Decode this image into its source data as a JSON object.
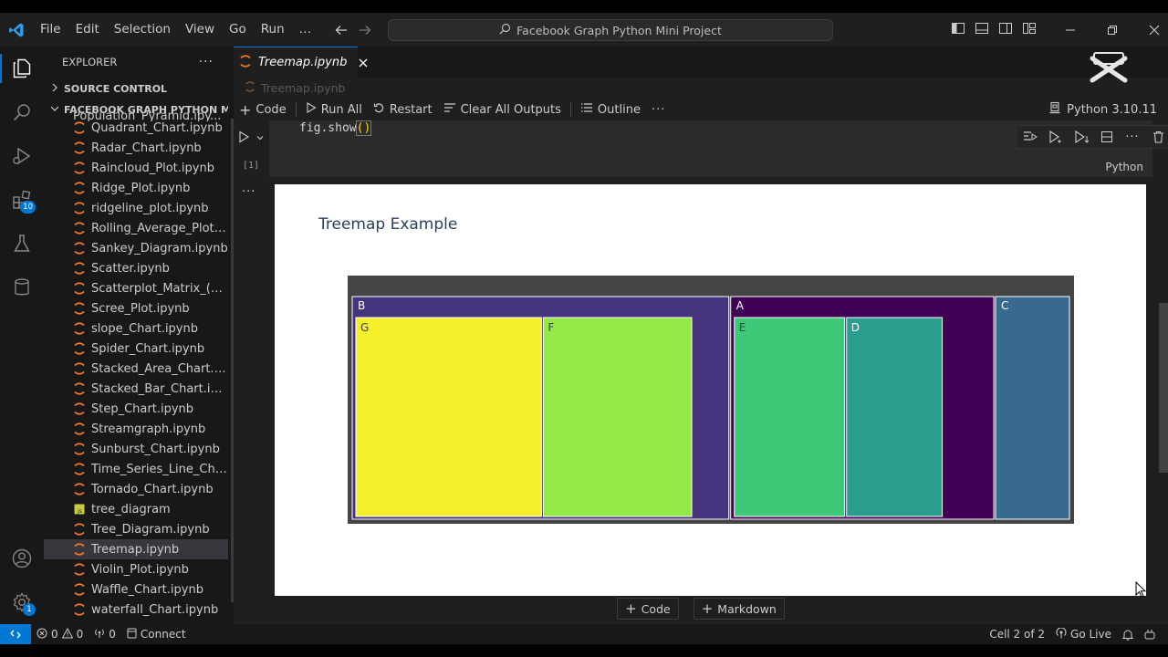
{
  "menu": {
    "items": [
      "File",
      "Edit",
      "Selection",
      "View",
      "Go",
      "Run",
      "…"
    ]
  },
  "command_center": {
    "text": "Facebook Graph Python Mini Project"
  },
  "sidebar": {
    "title": "EXPLORER",
    "more": "···",
    "source_control": "SOURCE CONTROL",
    "project": "FACEBOOK GRAPH PYTHON MI...",
    "partial_file": "Population_Pyramid.ipy...",
    "files": [
      {
        "name": "Quadrant_Chart.ipynb",
        "icon": "notebook-icon"
      },
      {
        "name": "Radar_Chart.ipynb",
        "icon": "notebook-icon"
      },
      {
        "name": "Raincloud_Plot.ipynb",
        "icon": "notebook-icon"
      },
      {
        "name": "Ridge_Plot.ipynb",
        "icon": "notebook-icon"
      },
      {
        "name": "ridgeline_plot.ipynb",
        "icon": "notebook-icon"
      },
      {
        "name": "Rolling_Average_Plot.ip...",
        "icon": "notebook-icon"
      },
      {
        "name": "Sankey_Diagram.ipynb",
        "icon": "notebook-icon"
      },
      {
        "name": "Scatter.ipynb",
        "icon": "notebook-icon"
      },
      {
        "name": "Scatterplot_Matrix_(SPL...",
        "icon": "notebook-icon"
      },
      {
        "name": "Scree_Plot.ipynb",
        "icon": "notebook-icon"
      },
      {
        "name": "slope_Chart.ipynb",
        "icon": "notebook-icon"
      },
      {
        "name": "Spider_Chart.ipynb",
        "icon": "notebook-icon"
      },
      {
        "name": "Stacked_Area_Chart.ipy...",
        "icon": "notebook-icon"
      },
      {
        "name": "Stacked_Bar_Chart.ipynb",
        "icon": "notebook-icon"
      },
      {
        "name": "Step_Chart.ipynb",
        "icon": "notebook-icon"
      },
      {
        "name": "Streamgraph.ipynb",
        "icon": "notebook-icon"
      },
      {
        "name": "Sunburst_Chart.ipynb",
        "icon": "notebook-icon"
      },
      {
        "name": "Time_Series_Line_Chart....",
        "icon": "notebook-icon"
      },
      {
        "name": "Tornado_Chart.ipynb",
        "icon": "notebook-icon"
      },
      {
        "name": "tree_diagram",
        "icon": "js-file-icon"
      },
      {
        "name": "Tree_Diagram.ipynb",
        "icon": "notebook-icon"
      },
      {
        "name": "Treemap.ipynb",
        "icon": "notebook-icon",
        "selected": true
      },
      {
        "name": "Violin_Plot.ipynb",
        "icon": "notebook-icon"
      },
      {
        "name": "Waffle_Chart.ipynb",
        "icon": "notebook-icon"
      },
      {
        "name": "waterfall_Chart.ipynb",
        "icon": "notebook-icon"
      }
    ]
  },
  "activity_bar": {
    "extensions_badge": "10",
    "settings_badge": "1"
  },
  "editor": {
    "tab_label": "Treemap.ipynb",
    "breadcrumb": "Treemap.ipynb",
    "toolbar": {
      "code": "Code",
      "run_all": "Run All",
      "restart": "Restart",
      "clear_outputs": "Clear All Outputs",
      "outline": "Outline",
      "more": "···",
      "kernel": "Python 3.10.11"
    },
    "cell": {
      "code_fn": "fig.show",
      "code_parens": "()",
      "exec_count": "[1]",
      "language": "Python",
      "output_more": "···"
    },
    "add_code": "Code",
    "add_markdown": "Markdown"
  },
  "chart_data": {
    "type": "treemap",
    "title": "Treemap Example",
    "nodes": [
      {
        "label": "B",
        "parent": "",
        "value": 50,
        "color": "#46347f"
      },
      {
        "label": "G",
        "parent": "B",
        "value": 25,
        "color": "#f6ef2c"
      },
      {
        "label": "F",
        "parent": "B",
        "value": 20,
        "color": "#94e946"
      },
      {
        "label": "A",
        "parent": "",
        "value": 35,
        "color": "#3f0056"
      },
      {
        "label": "E",
        "parent": "A",
        "value": 15,
        "color": "#3ec979"
      },
      {
        "label": "D",
        "parent": "A",
        "value": 13,
        "color": "#2a9d8f"
      },
      {
        "label": "C",
        "parent": "",
        "value": 10,
        "color": "#38698f"
      }
    ]
  },
  "statusbar": {
    "errors": "0",
    "warnings": "0",
    "ports": "0",
    "connect": "Connect",
    "cell_position": "Cell 2 of 2",
    "go_live": "Go Live"
  }
}
